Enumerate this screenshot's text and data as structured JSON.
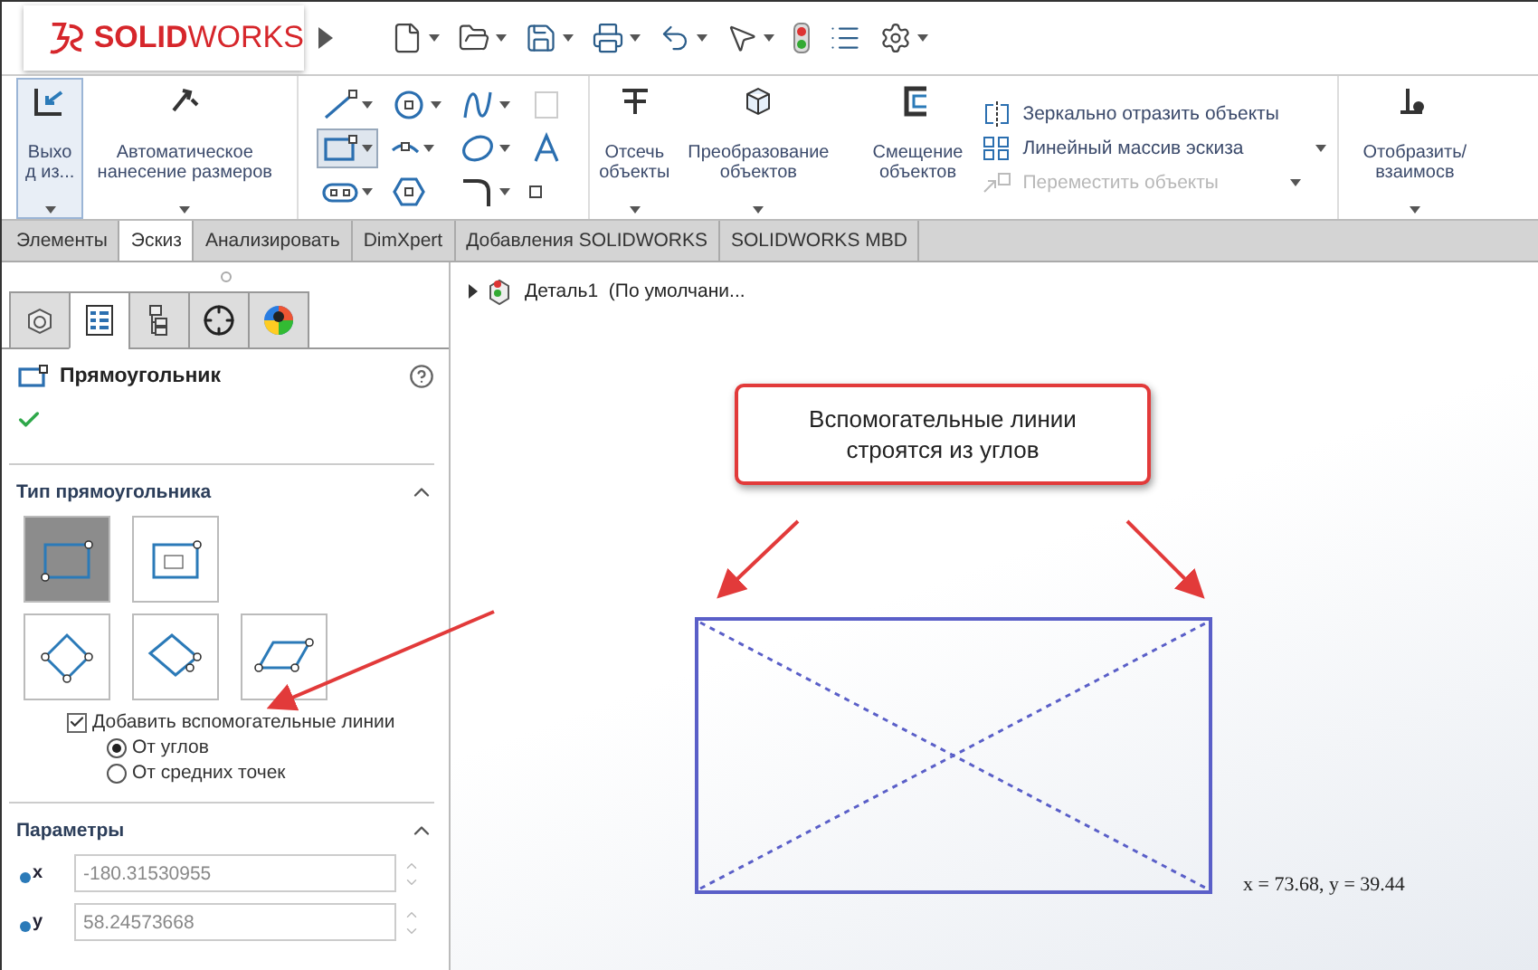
{
  "logo": {
    "text": "**SOLID**WORKS"
  },
  "quick_tools": [
    {
      "kind": "new",
      "dropdown": true
    },
    {
      "kind": "open",
      "dropdown": true
    },
    {
      "kind": "save",
      "dropdown": true
    },
    {
      "kind": "print",
      "dropdown": true
    },
    {
      "kind": "undo",
      "dropdown": true
    },
    {
      "kind": "select",
      "dropdown": true
    },
    {
      "kind": "rebuild",
      "dropdown": false
    },
    {
      "kind": "options-list",
      "dropdown": false
    },
    {
      "kind": "settings",
      "dropdown": true
    }
  ],
  "ribbon": {
    "exit": {
      "label": [
        "Выхо",
        "д из..."
      ],
      "selected": true
    },
    "auto_dimension": {
      "label": [
        "Автоматическое",
        "нанесение размеров"
      ]
    },
    "sketch_tools": [
      {
        "kind": "line",
        "dropdown": true,
        "selected": false
      },
      {
        "kind": "circle",
        "dropdown": true,
        "selected": false
      },
      {
        "kind": "spline",
        "dropdown": true,
        "selected": false
      },
      {
        "kind": "plane",
        "dropdown": false,
        "selected": false
      },
      {
        "kind": "rectangle",
        "dropdown": true,
        "selected": true
      },
      {
        "kind": "slot-arc",
        "dropdown": true,
        "selected": false
      },
      {
        "kind": "ellipse",
        "dropdown": true,
        "selected": false
      },
      {
        "kind": "text",
        "dropdown": false,
        "selected": false
      },
      {
        "kind": "slot",
        "dropdown": true,
        "selected": false
      },
      {
        "kind": "polygon",
        "dropdown": false,
        "selected": false
      },
      {
        "kind": "fillet",
        "dropdown": true,
        "selected": false
      },
      {
        "kind": "point",
        "dropdown": false,
        "selected": false
      }
    ],
    "trim": {
      "label": [
        "Отсечь",
        "объекты"
      ]
    },
    "convert": {
      "label": [
        "Преобразование",
        "объектов"
      ]
    },
    "offset": {
      "label": [
        "Смещение",
        "объектов"
      ]
    },
    "list_tools": [
      {
        "kind": "mirror",
        "label": "Зеркально отразить объекты",
        "disabled": false
      },
      {
        "kind": "linear",
        "label": "Линейный массив эскиза",
        "disabled": false
      },
      {
        "kind": "move",
        "label": "Переместить объекты",
        "disabled": true
      }
    ],
    "relations": {
      "label": [
        "Отобразить/",
        "взаимосв"
      ]
    }
  },
  "tabs": [
    {
      "label": "Элементы",
      "selected": false
    },
    {
      "label": "Эскиз",
      "selected": true
    },
    {
      "label": "Анализировать",
      "selected": false
    },
    {
      "label": "DimXpert",
      "selected": false
    },
    {
      "label": "Добавления SOLIDWORKS",
      "selected": false
    },
    {
      "label": "SOLIDWORKS MBD",
      "selected": false
    }
  ],
  "panel": {
    "tabs": [
      {
        "kind": "features",
        "selected": false
      },
      {
        "kind": "properties",
        "selected": true
      },
      {
        "kind": "config",
        "selected": false
      },
      {
        "kind": "dimxpert",
        "selected": false
      },
      {
        "kind": "appearance",
        "selected": false
      }
    ],
    "title": "Прямоугольник",
    "section_type": {
      "title": "Тип прямоугольника",
      "expanded": true,
      "types": [
        {
          "kind": "corner",
          "selected": true
        },
        {
          "kind": "center",
          "selected": false
        },
        {
          "kind": "three-point-corner",
          "selected": false
        },
        {
          "kind": "three-point-center",
          "selected": false
        },
        {
          "kind": "parallelogram",
          "selected": false
        }
      ],
      "construction": {
        "label": "Добавить вспомогательные линии",
        "checked": true
      },
      "options": [
        {
          "label": "От углов",
          "selected": true
        },
        {
          "label": "От средних точек",
          "selected": false
        }
      ]
    },
    "section_params": {
      "title": "Параметры",
      "expanded": true,
      "fields": [
        {
          "axis": "x",
          "value": "-180.31530955"
        },
        {
          "axis": "y",
          "value": "58.24573668"
        }
      ]
    }
  },
  "canvas": {
    "tree_item": "Деталь1  (По умолчани...",
    "callout": [
      "Вспомогательные линии",
      "строятся из углов"
    ],
    "coordinates": "x = 73.68, y = 39.44"
  }
}
